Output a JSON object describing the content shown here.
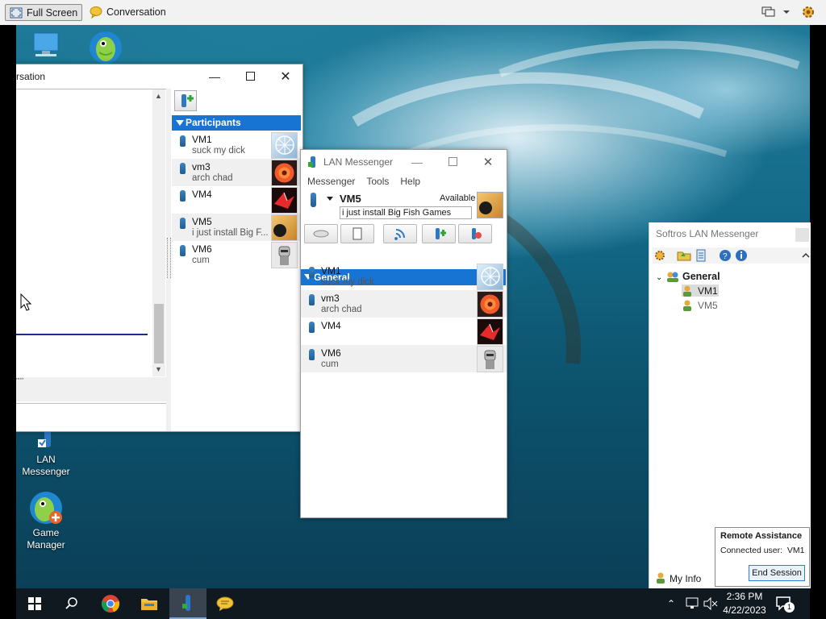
{
  "toolbar": {
    "full_screen_label": "Full Screen",
    "conversation_label": "Conversation"
  },
  "desktop_icons": {
    "lan_messenger": "LAN Messenger",
    "game_manager_line1": "Game",
    "game_manager_line2": "Manager"
  },
  "conversation_window": {
    "title": "rsation",
    "participants_header": "Participants",
    "participants": [
      {
        "name": "VM1",
        "note": "suck my dick"
      },
      {
        "name": "vm3",
        "note": "arch chad"
      },
      {
        "name": "VM4",
        "note": ""
      },
      {
        "name": "VM5",
        "note": "i just install Big F..."
      },
      {
        "name": "VM6",
        "note": "cum"
      }
    ]
  },
  "lan_window": {
    "title": "LAN Messenger",
    "menu": [
      "Messenger",
      "Tools",
      "Help"
    ],
    "self_name": "VM5",
    "self_status": "Available",
    "self_note": "i just install Big Fish Games",
    "group_header": "General",
    "users": [
      {
        "name": "VM1",
        "note": "suck my dick"
      },
      {
        "name": "vm3",
        "note": "arch chad"
      },
      {
        "name": "VM4",
        "note": ""
      },
      {
        "name": "VM6",
        "note": "cum"
      }
    ]
  },
  "softros": {
    "title": "Softros LAN Messenger",
    "group": "General",
    "users": [
      "VM1",
      "VM5"
    ],
    "my_info": "My Info"
  },
  "remote_assistance": {
    "title": "Remote Assistance",
    "connected": "Connected user:  VM1",
    "end_session": "End Session"
  },
  "clock": {
    "time": "2:36 PM",
    "date": "4/22/2023"
  },
  "notification_count": "1",
  "colors": {
    "accent": "#1874d2",
    "taskbar": "#101820"
  }
}
